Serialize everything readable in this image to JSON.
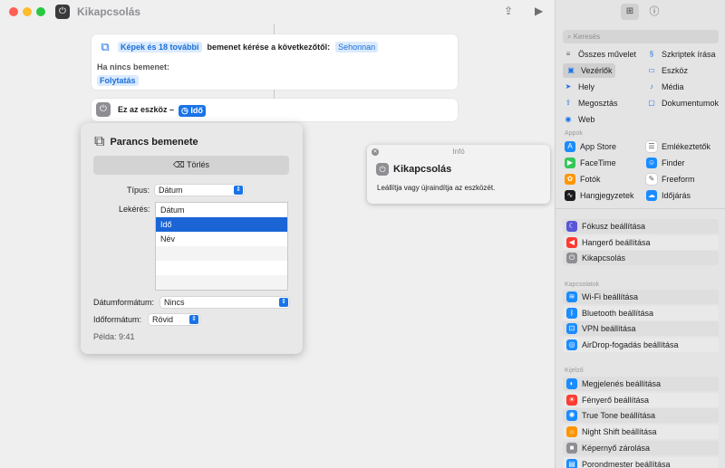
{
  "window": {
    "title": "Kikapcsolás"
  },
  "canvas": {
    "card1": {
      "chip": "Képek és 18 további",
      "middle_text": "bemenet kérése a következőtől:",
      "source_chip": "Sehonnan",
      "no_input_label": "Ha nincs bemenet:",
      "continue_chip": "Folytatás"
    },
    "card2": {
      "text": "Ez az eszköz –",
      "param_chip": "Idő"
    }
  },
  "popover": {
    "title": "Parancs bemenete",
    "clear_button": "Törlés",
    "type_label": "Típus:",
    "type_value": "Dátum",
    "request_label": "Lekérés:",
    "request_options": [
      "Dátum",
      "Idő",
      "Név",
      "",
      "",
      ""
    ],
    "date_format_label": "Dátumformátum:",
    "date_format_value": "Nincs",
    "time_format_label": "Időformátum:",
    "time_format_value": "Rövid",
    "example": "Példa: 9:41"
  },
  "info": {
    "header": "Infó",
    "title": "Kikapcsolás",
    "description": "Leállítja vagy újraindítja az eszközét."
  },
  "sidebar": {
    "search_placeholder": "Keresés",
    "categories": [
      {
        "label": "Összes művelet",
        "icon": "list-icon",
        "color": "#5a5a5a"
      },
      {
        "label": "Szkriptek írása",
        "icon": "scripting-icon",
        "color": "#1a73e8"
      },
      {
        "label": "Vezérlők",
        "icon": "controls-icon",
        "color": "#1a73e8"
      },
      {
        "label": "Eszköz",
        "icon": "device-icon",
        "color": "#1a73e8"
      },
      {
        "label": "Hely",
        "icon": "location-icon",
        "color": "#1a73e8"
      },
      {
        "label": "Média",
        "icon": "music-icon",
        "color": "#1a73e8"
      },
      {
        "label": "Megosztás",
        "icon": "share-icon",
        "color": "#1a73e8"
      },
      {
        "label": "Dokumentumok",
        "icon": "document-icon",
        "color": "#1a73e8"
      },
      {
        "label": "Web",
        "icon": "web-icon",
        "color": "#1a73e8"
      }
    ],
    "apps_section": "Appok",
    "apps": [
      {
        "label": "App Store",
        "icon": "app-store-icon",
        "color": "#1a8cff"
      },
      {
        "label": "Emlékeztetők",
        "icon": "reminders-icon",
        "color": "#ffffff"
      },
      {
        "label": "FaceTime",
        "icon": "facetime-icon",
        "color": "#34c759"
      },
      {
        "label": "Finder",
        "icon": "finder-icon",
        "color": "#1a8cff"
      },
      {
        "label": "Fotók",
        "icon": "photos-icon",
        "color": "#ff9500"
      },
      {
        "label": "Freeform",
        "icon": "freeform-icon",
        "color": "#ffffff"
      },
      {
        "label": "Hangjegyzetek",
        "icon": "voice-memos-icon",
        "color": "#1c1c1e"
      },
      {
        "label": "Időjárás",
        "icon": "weather-icon",
        "color": "#1a8cff"
      }
    ],
    "top_actions": [
      {
        "label": "Fókusz beállítása",
        "icon": "focus-icon",
        "color": "#5856d6"
      },
      {
        "label": "Hangerő beállítása",
        "icon": "volume-icon",
        "color": "#ff3b30"
      },
      {
        "label": "Kikapcsolás",
        "icon": "power-icon",
        "color": "#8e8e93"
      }
    ],
    "connections_section": "Kapcsolatok",
    "connections": [
      {
        "label": "Wi-Fi beállítása",
        "icon": "wifi-icon",
        "color": "#1a8cff"
      },
      {
        "label": "Bluetooth beállítása",
        "icon": "bluetooth-icon",
        "color": "#1a8cff"
      },
      {
        "label": "VPN beállítása",
        "icon": "vpn-icon",
        "color": "#1a8cff"
      },
      {
        "label": "AirDrop-fogadás beállítása",
        "icon": "airdrop-icon",
        "color": "#1a8cff"
      }
    ],
    "display_section": "Kijelző",
    "display": [
      {
        "label": "Megjelenés beállítása",
        "icon": "appearance-icon",
        "color": "#1a8cff"
      },
      {
        "label": "Fényerő beállítása",
        "icon": "brightness-icon",
        "color": "#ff3b30"
      },
      {
        "label": "True Tone beállítása",
        "icon": "true-tone-icon",
        "color": "#1a8cff"
      },
      {
        "label": "Night Shift beállítása",
        "icon": "night-shift-icon",
        "color": "#ff9500"
      },
      {
        "label": "Képernyő zárolása",
        "icon": "lock-screen-icon",
        "color": "#8e8e93"
      },
      {
        "label": "Porondmester beállítása",
        "icon": "stage-manager-icon",
        "color": "#1a8cff"
      }
    ]
  }
}
